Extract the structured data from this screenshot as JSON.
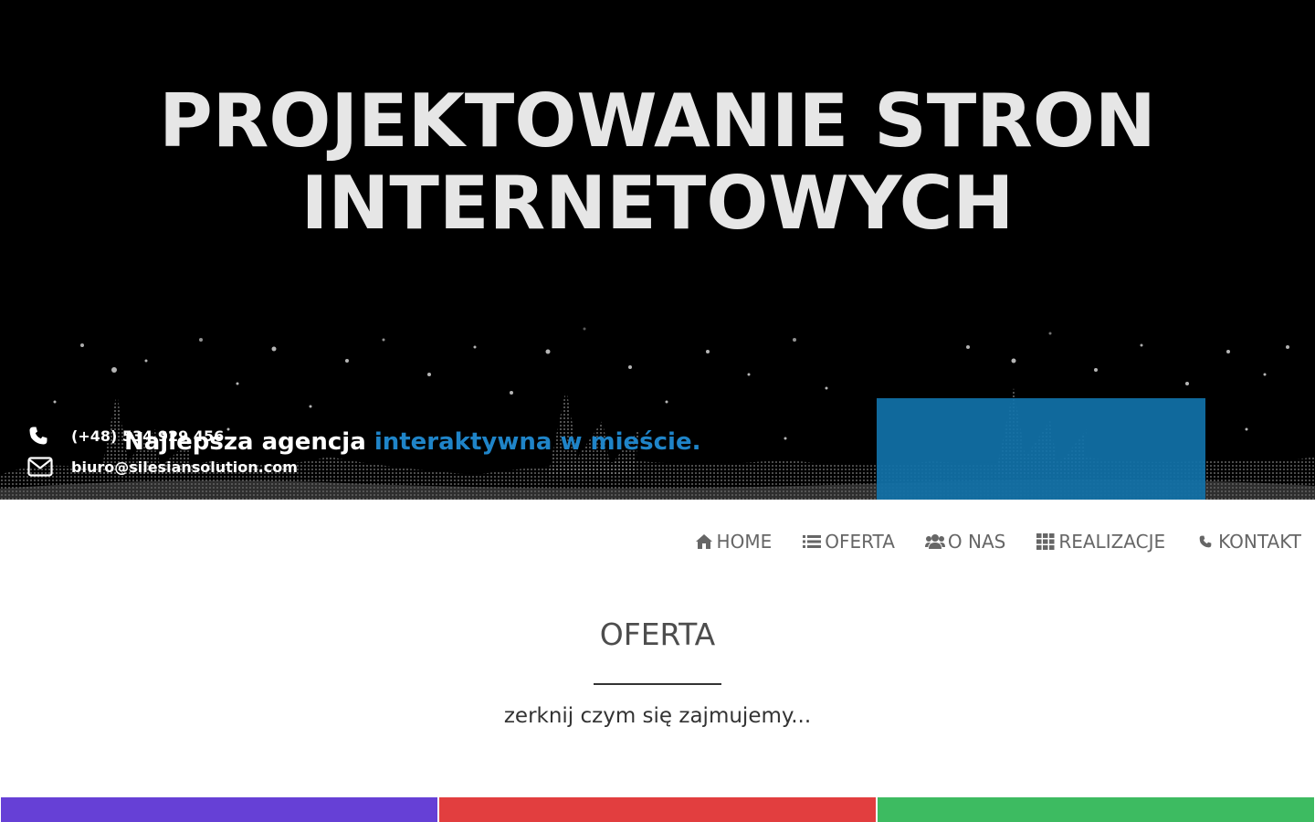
{
  "hero": {
    "title_line1": "PROJEKTOWANIE STRON",
    "title_line2": "INTERNETOWYCH",
    "tagline_white": "Najlepsza agencja ",
    "tagline_blue": "interaktywna w mieście."
  },
  "contact": {
    "phone": "(+48) 534 929 456",
    "email": "biuro@silesiansolution.com",
    "box_color": "#1171a8"
  },
  "nav": {
    "items": [
      {
        "label": "HOME",
        "icon": "home-icon"
      },
      {
        "label": "OFERTA",
        "icon": "list-icon"
      },
      {
        "label": "O NAS",
        "icon": "users-icon"
      },
      {
        "label": "REALIZACJE",
        "icon": "grid-icon"
      },
      {
        "label": "KONTAKT",
        "icon": "phone-icon"
      }
    ]
  },
  "section": {
    "title": "OFERTA",
    "subtitle": "zerknij czym się zajmujemy..."
  },
  "colors": {
    "accent_blue": "#1f84c8",
    "block_purple": "#6640d6",
    "block_red": "#e23e3f",
    "block_green": "#3dbb61"
  }
}
